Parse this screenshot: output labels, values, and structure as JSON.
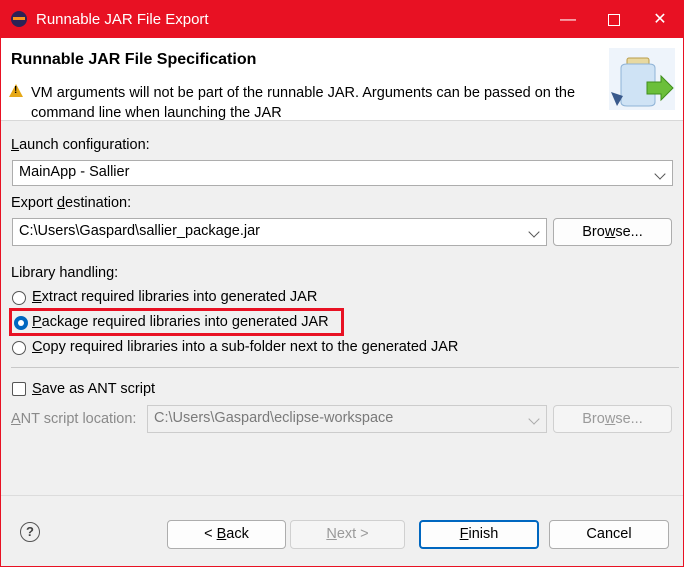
{
  "window": {
    "title": "Runnable JAR File Export",
    "minimize_glyph": "—",
    "close_glyph": "✕"
  },
  "header": {
    "title": "Runnable JAR File Specification",
    "warning": "VM arguments will not be part of the runnable JAR. Arguments can be passed on the command line when launching the JAR"
  },
  "launch": {
    "label_pre": "",
    "label_u": "L",
    "label_post": "aunch configuration:",
    "value": "MainApp - Sallier"
  },
  "export": {
    "label_pre": "Export ",
    "label_u": "d",
    "label_post": "estination:",
    "value": "C:\\Users\\Gaspard\\sallier_package.jar",
    "browse_pre": "Bro",
    "browse_u": "w",
    "browse_post": "se..."
  },
  "library": {
    "label": "Library handling:",
    "options": [
      {
        "pre": "",
        "u": "E",
        "post": "xtract required libraries into generated JAR",
        "checked": false
      },
      {
        "pre": "",
        "u": "P",
        "post": "ackage required libraries into generated JAR",
        "checked": true
      },
      {
        "pre": "",
        "u": "C",
        "post": "opy required libraries into a sub-folder next to the generated JAR",
        "checked": false
      }
    ]
  },
  "ant": {
    "checkbox_pre": "",
    "checkbox_u": "S",
    "checkbox_post": "ave as ANT script",
    "checked": false,
    "location_pre": "",
    "location_u": "A",
    "location_post": "NT script location:",
    "location_value": "C:\\Users\\Gaspard\\eclipse-workspace",
    "browse_pre": "Bro",
    "browse_u": "w",
    "browse_post": "se..."
  },
  "footer": {
    "help_glyph": "?",
    "back_pre": "< ",
    "back_u": "B",
    "back_post": "ack",
    "next_pre": "",
    "next_u": "N",
    "next_post": "ext >",
    "finish_pre": "",
    "finish_u": "F",
    "finish_post": "inish",
    "cancel": "Cancel"
  },
  "colors": {
    "titlebar": "#e81123",
    "accent": "#0067c0",
    "highlight": "#e81123"
  }
}
